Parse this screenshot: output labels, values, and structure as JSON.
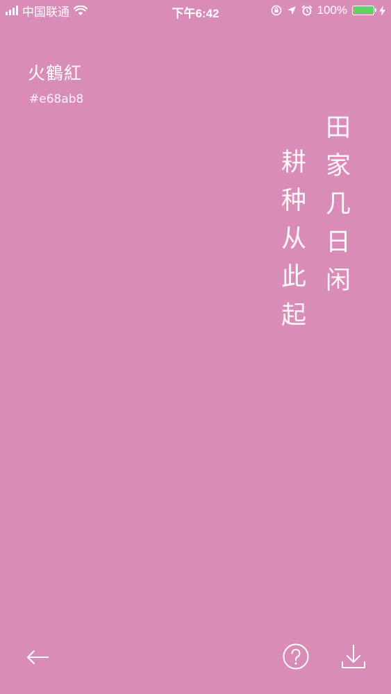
{
  "status_bar": {
    "carrier": "中国联通",
    "time": "下午6:42",
    "battery_percent": "100%",
    "battery_level": 1.0,
    "battery_color": "#5fd35f",
    "icons": [
      "signal-icon",
      "wifi-icon",
      "orientation-lock-icon",
      "location-icon",
      "alarm-icon",
      "battery-icon",
      "charging-icon"
    ]
  },
  "color": {
    "name": "火鶴紅",
    "hex_label": "#e68ab8",
    "background": "#d98cb6"
  },
  "poem": {
    "lines": [
      "田家几日闲",
      "耕种从此起"
    ]
  },
  "toolbar": {
    "icons": [
      "back-arrow-icon",
      "help-icon",
      "download-icon"
    ]
  }
}
